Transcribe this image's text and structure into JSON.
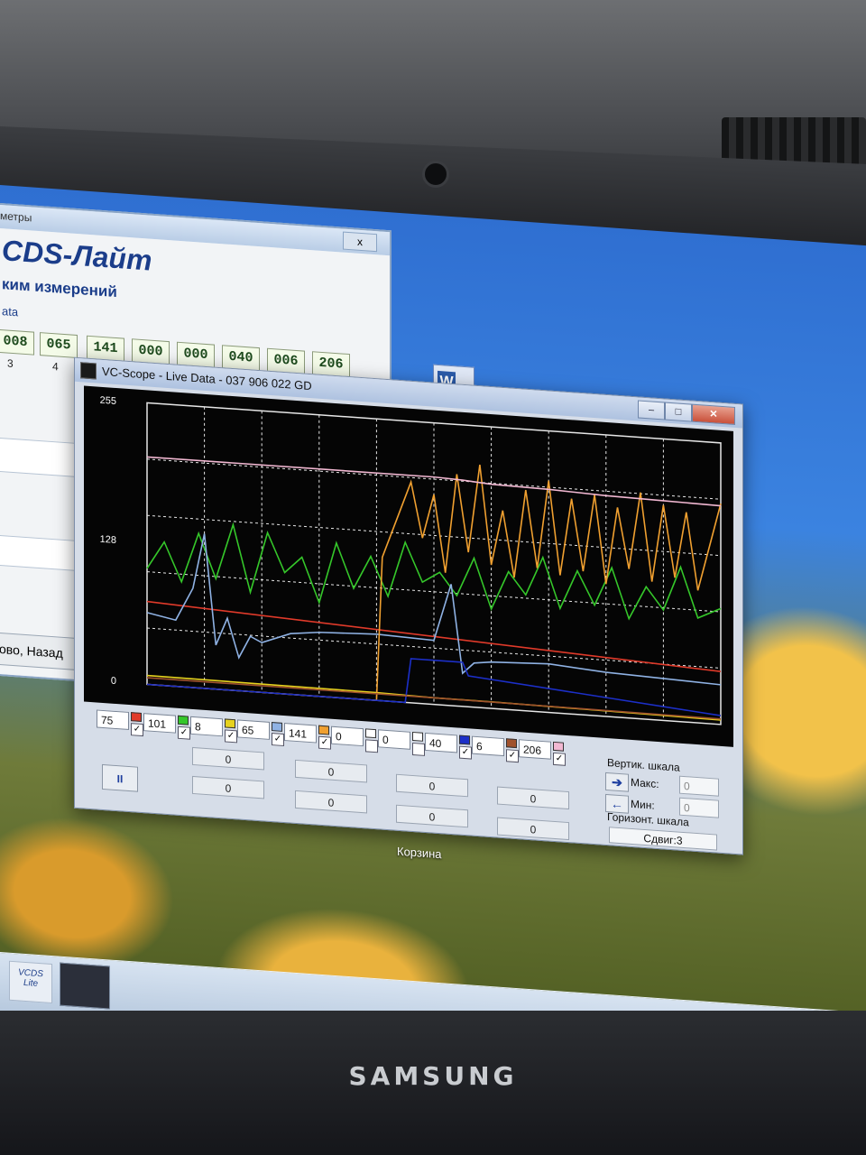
{
  "laptop": {
    "brand": "SAMSUNG"
  },
  "desktop": {
    "trash_label": "Корзина",
    "word_icon_letter": "W"
  },
  "back_window": {
    "title": "метры",
    "close_glyph": "x",
    "app_title": "CDS-Лайт",
    "app_subtitle": "ким измерений",
    "data_label": "ata",
    "values": [
      "008",
      "065",
      "141",
      "000",
      "000",
      "040",
      "006",
      "206"
    ],
    "indices": [
      "3",
      "4"
    ],
    "back_button": "ово, Назад"
  },
  "scope_window": {
    "title": "VC-Scope  -  Live Data  -  037 906 022 GD",
    "buttons": {
      "minimize": "–",
      "maximize": "□",
      "close": "✕"
    },
    "plot": {
      "y_tick_labels": [
        "255",
        "128",
        "0"
      ],
      "background": "#000000",
      "grid_color": "#e6e6e6"
    },
    "channels": [
      {
        "value": "75",
        "color": "#e03a2a",
        "checked": true
      },
      {
        "value": "101",
        "color": "#35c72a",
        "checked": true
      },
      {
        "value": "8",
        "color": "#e6d21e",
        "checked": true
      },
      {
        "value": "65",
        "color": "#8fb2e4",
        "checked": true
      },
      {
        "value": "141",
        "color": "#f0a030",
        "checked": true
      },
      {
        "value": "0",
        "color": "#ffffff",
        "checked": false
      },
      {
        "value": "0",
        "color": "#ffffff",
        "checked": false
      },
      {
        "value": "40",
        "color": "#1c2fc8",
        "checked": true
      },
      {
        "value": "6",
        "color": "#a0522d",
        "checked": true
      },
      {
        "value": "206",
        "color": "#f2b8d2",
        "checked": true
      }
    ],
    "zero_fields": [
      "0",
      "0",
      "0",
      "0",
      "0",
      "0",
      "0",
      "0"
    ],
    "pause_glyph": "II",
    "vertical_scale": {
      "label": "Вертик. шкала",
      "max_label": "Макс:",
      "min_label": "Мин:",
      "max_value": "0",
      "min_value": "0"
    },
    "horizontal_scale": {
      "label": "Горизонт. шкала",
      "shift": "Сдвиг:3"
    }
  },
  "taskbar": {
    "vcds_label": "VCDS Lite"
  },
  "chart_data": {
    "type": "line",
    "ylim": [
      0,
      255
    ],
    "y_ticks": [
      0,
      128,
      255
    ],
    "xlim": [
      0,
      100
    ],
    "series": [
      {
        "color": "#e03a2a",
        "x": [
          0,
          100
        ],
        "values": [
          75,
          48
        ]
      },
      {
        "color": "#35c72a",
        "x": [
          0,
          3,
          6,
          9,
          12,
          15,
          18,
          21,
          24,
          27,
          30,
          33,
          36,
          39,
          42,
          45,
          48,
          51,
          54,
          57,
          60,
          63,
          66,
          69,
          72,
          75,
          78,
          81,
          84,
          87,
          90,
          93,
          96,
          100
        ],
        "values": [
          105,
          130,
          95,
          140,
          100,
          150,
          90,
          145,
          110,
          125,
          85,
          140,
          100,
          130,
          95,
          145,
          110,
          120,
          100,
          135,
          90,
          125,
          105,
          140,
          95,
          130,
          100,
          135,
          90,
          120,
          100,
          140,
          95,
          105
        ]
      },
      {
        "color": "#e6d21e",
        "x": [
          0,
          40,
          50,
          60,
          80,
          100
        ],
        "values": [
          8,
          7,
          6,
          6,
          5,
          4
        ]
      },
      {
        "color": "#8fb2e4",
        "x": [
          0,
          5,
          8,
          10,
          12,
          14,
          16,
          18,
          20,
          25,
          30,
          40,
          50,
          53,
          55,
          57,
          60,
          70,
          80,
          90,
          100
        ],
        "values": [
          65,
          60,
          90,
          140,
          40,
          65,
          30,
          50,
          45,
          55,
          58,
          60,
          58,
          110,
          30,
          40,
          42,
          44,
          40,
          38,
          36
        ]
      },
      {
        "color": "#f0a030",
        "x": [
          0,
          40,
          41,
          46,
          48,
          50,
          52,
          54,
          56,
          58,
          60,
          62,
          64,
          66,
          68,
          70,
          72,
          74,
          76,
          78,
          80,
          82,
          84,
          86,
          88,
          90,
          92,
          94,
          96,
          100
        ],
        "values": [
          0,
          0,
          130,
          200,
          150,
          190,
          120,
          210,
          140,
          220,
          130,
          180,
          120,
          200,
          130,
          210,
          125,
          195,
          130,
          200,
          120,
          190,
          135,
          205,
          125,
          195,
          130,
          190,
          120,
          200
        ]
      },
      {
        "color": "#1c2fc8",
        "x": [
          0,
          45,
          46,
          55,
          56,
          100
        ],
        "values": [
          0,
          0,
          40,
          40,
          28,
          8
        ]
      },
      {
        "color": "#a0522d",
        "x": [
          0,
          50,
          100
        ],
        "values": [
          6,
          6,
          5
        ]
      },
      {
        "color": "#f2b8d2",
        "x": [
          0,
          50,
          55,
          60,
          70,
          80,
          90,
          100
        ],
        "values": [
          206,
          206,
          205,
          203,
          202,
          200,
          199,
          198
        ]
      }
    ]
  }
}
